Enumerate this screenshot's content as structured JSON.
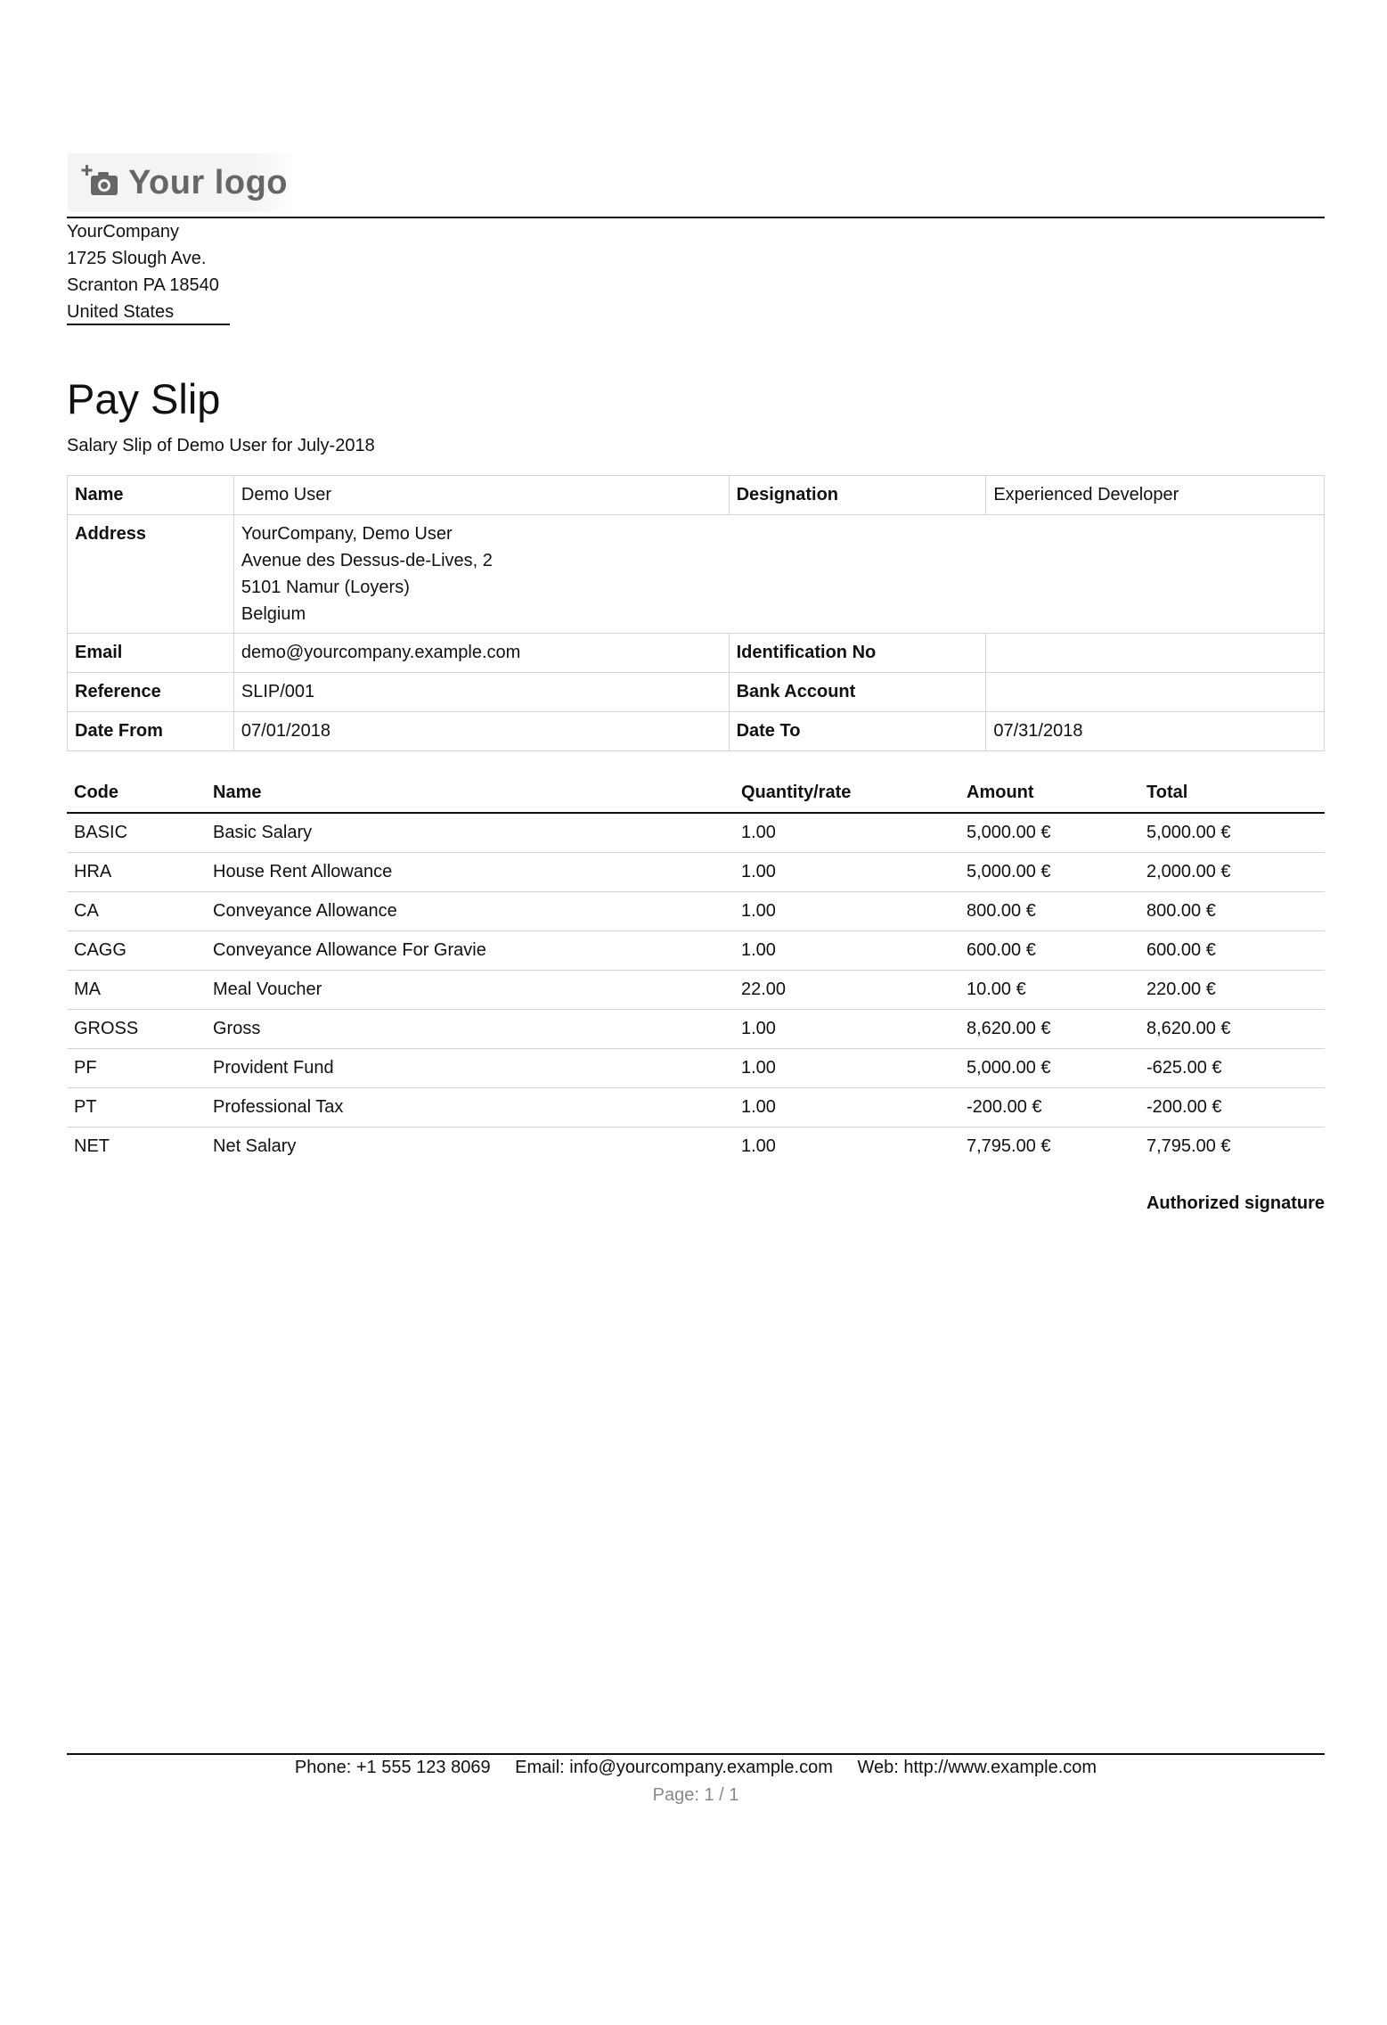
{
  "logo": {
    "text": "Your logo",
    "icon": "camera-add-icon"
  },
  "company": {
    "lines": [
      "YourCompany",
      "1725 Slough Ave.",
      "Scranton PA 18540",
      "United States"
    ]
  },
  "title": "Pay Slip",
  "subtitle": "Salary Slip of Demo User for July-2018",
  "info": {
    "name_label": "Name",
    "name_value": "Demo User",
    "designation_label": "Designation",
    "designation_value": "Experienced Developer",
    "address_label": "Address",
    "address_lines": [
      "YourCompany, Demo User",
      "Avenue des Dessus-de-Lives, 2",
      "5101 Namur (Loyers)",
      "Belgium"
    ],
    "email_label": "Email",
    "email_value": "demo@yourcompany.example.com",
    "identification_label": "Identification No",
    "identification_value": "",
    "reference_label": "Reference",
    "reference_value": "SLIP/001",
    "bank_label": "Bank Account",
    "bank_value": "",
    "date_from_label": "Date From",
    "date_from_value": "07/01/2018",
    "date_to_label": "Date To",
    "date_to_value": "07/31/2018"
  },
  "lines_table": {
    "headers": [
      "Code",
      "Name",
      "Quantity/rate",
      "Amount",
      "Total"
    ],
    "rows": [
      [
        "BASIC",
        "Basic Salary",
        "1.00",
        "5,000.00 €",
        "5,000.00 €"
      ],
      [
        "HRA",
        "House Rent Allowance",
        "1.00",
        "5,000.00 €",
        "2,000.00 €"
      ],
      [
        "CA",
        "Conveyance Allowance",
        "1.00",
        "800.00 €",
        "800.00 €"
      ],
      [
        "CAGG",
        "Conveyance Allowance For Gravie",
        "1.00",
        "600.00 €",
        "600.00 €"
      ],
      [
        "MA",
        "Meal Voucher",
        "22.00",
        "10.00 €",
        "220.00 €"
      ],
      [
        "GROSS",
        "Gross",
        "1.00",
        "8,620.00 €",
        "8,620.00 €"
      ],
      [
        "PF",
        "Provident Fund",
        "1.00",
        "5,000.00 €",
        "-625.00 €"
      ],
      [
        "PT",
        "Professional Tax",
        "1.00",
        "-200.00 €",
        "-200.00 €"
      ],
      [
        "NET",
        "Net Salary",
        "1.00",
        "7,795.00 €",
        "7,795.00 €"
      ]
    ]
  },
  "signature": "Authorized signature",
  "footer": {
    "phone": "Phone: +1 555 123 8069",
    "email": "Email: info@yourcompany.example.com",
    "web": "Web: http://www.example.com",
    "page": "Page: 1 / 1"
  }
}
